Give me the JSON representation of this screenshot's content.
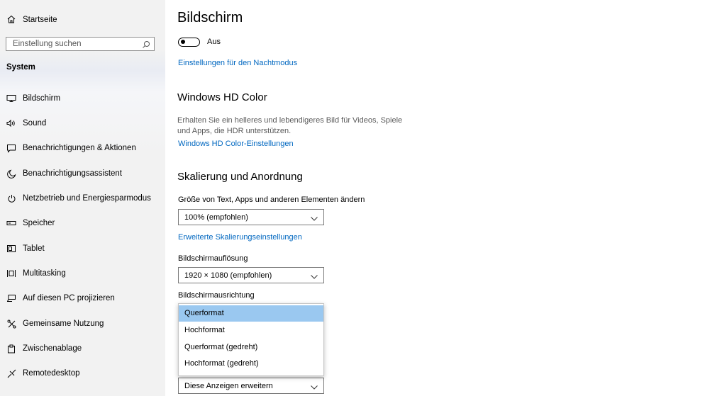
{
  "sidebar": {
    "home_label": "Startseite",
    "search_placeholder": "Einstellung suchen",
    "section_title": "System",
    "items": [
      {
        "label": "Bildschirm",
        "icon": "monitor-icon"
      },
      {
        "label": "Sound",
        "icon": "speaker-icon"
      },
      {
        "label": "Benachrichtigungen & Aktionen",
        "icon": "message-icon"
      },
      {
        "label": "Benachrichtigungsassistent",
        "icon": "moon-icon"
      },
      {
        "label": "Netzbetrieb und Energiesparmodus",
        "icon": "power-icon"
      },
      {
        "label": "Speicher",
        "icon": "storage-icon"
      },
      {
        "label": "Tablet",
        "icon": "tablet-icon"
      },
      {
        "label": "Multitasking",
        "icon": "multitasking-icon"
      },
      {
        "label": "Auf diesen PC projizieren",
        "icon": "project-icon"
      },
      {
        "label": "Gemeinsame Nutzung",
        "icon": "share-icon"
      },
      {
        "label": "Zwischenablage",
        "icon": "clipboard-icon"
      },
      {
        "label": "Remotedesktop",
        "icon": "remote-icon"
      }
    ]
  },
  "main": {
    "title": "Bildschirm",
    "night_toggle_state": "Aus",
    "night_link": "Einstellungen für den Nachtmodus",
    "hdr": {
      "title": "Windows HD Color",
      "description": "Erhalten Sie ein helleres und lebendigeres Bild für Videos, Spiele und Apps, die HDR unterstützen.",
      "link": "Windows HD Color-Einstellungen"
    },
    "scale": {
      "title": "Skalierung und Anordnung",
      "size_label": "Größe von Text, Apps und anderen Elementen ändern",
      "size_value": "100% (empfohlen)",
      "advanced_link": "Erweiterte Skalierungseinstellungen",
      "resolution_label": "Bildschirmauflösung",
      "resolution_value": "1920 × 1080 (empfohlen)",
      "orientation_label": "Bildschirmausrichtung",
      "orientation_options": [
        "Querformat",
        "Hochformat",
        "Querformat (gedreht)",
        "Hochformat (gedreht)"
      ],
      "orientation_selected": "Querformat",
      "multi_display_value": "Diese Anzeigen erweitern"
    }
  }
}
